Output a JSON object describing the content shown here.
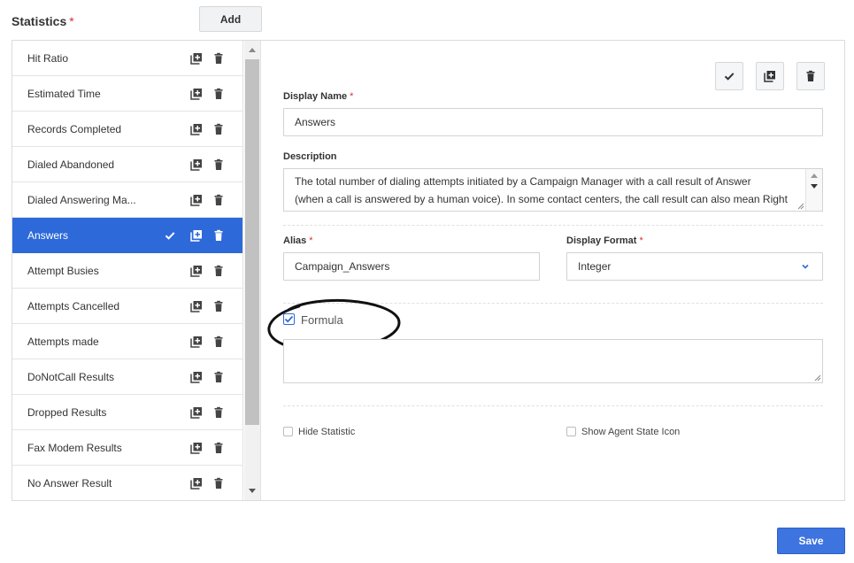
{
  "header": {
    "title": "Statistics",
    "required_mark": "*",
    "add_label": "Add"
  },
  "list": {
    "items": [
      {
        "label": "Hit Ratio",
        "selected": false
      },
      {
        "label": "Estimated Time",
        "selected": false
      },
      {
        "label": "Records Completed",
        "selected": false
      },
      {
        "label": "Dialed Abandoned",
        "selected": false
      },
      {
        "label": "Dialed Answering Ma...",
        "selected": false
      },
      {
        "label": "Answers",
        "selected": true
      },
      {
        "label": "Attempt Busies",
        "selected": false
      },
      {
        "label": "Attempts Cancelled",
        "selected": false
      },
      {
        "label": "Attempts made",
        "selected": false
      },
      {
        "label": "DoNotCall Results",
        "selected": false
      },
      {
        "label": "Dropped Results",
        "selected": false
      },
      {
        "label": "Fax Modem Results",
        "selected": false
      },
      {
        "label": "No Answer Result",
        "selected": false
      }
    ],
    "row_icons": [
      "copy-icon",
      "trash-icon"
    ],
    "selected_icon": "checkmark-icon"
  },
  "detail": {
    "toolbar_icons": [
      "checkmark-icon",
      "copy-icon",
      "trash-icon"
    ],
    "display_name": {
      "label": "Display Name",
      "required_mark": "*",
      "value": "Answers"
    },
    "description": {
      "label": "Description",
      "line1": "The total number of dialing attempts initiated by a Campaign Manager with a call result of Answer",
      "line2": "(when a call is answered by a human voice). In some contact centers, the call result can also mean Right"
    },
    "alias": {
      "label": "Alias",
      "required_mark": "*",
      "value": "Campaign_Answers"
    },
    "display_format": {
      "label": "Display Format",
      "required_mark": "*",
      "value": "Integer"
    },
    "formula": {
      "label": "Formula",
      "checked": true,
      "value": ""
    },
    "hide_statistic": {
      "label": "Hide Statistic",
      "checked": false
    },
    "show_agent_state_icon": {
      "label": "Show Agent State Icon",
      "checked": false
    }
  },
  "footer": {
    "save_label": "Save"
  },
  "colors": {
    "accent": "#2e69d9",
    "required": "#d0343b",
    "save": "#3d74e0"
  }
}
